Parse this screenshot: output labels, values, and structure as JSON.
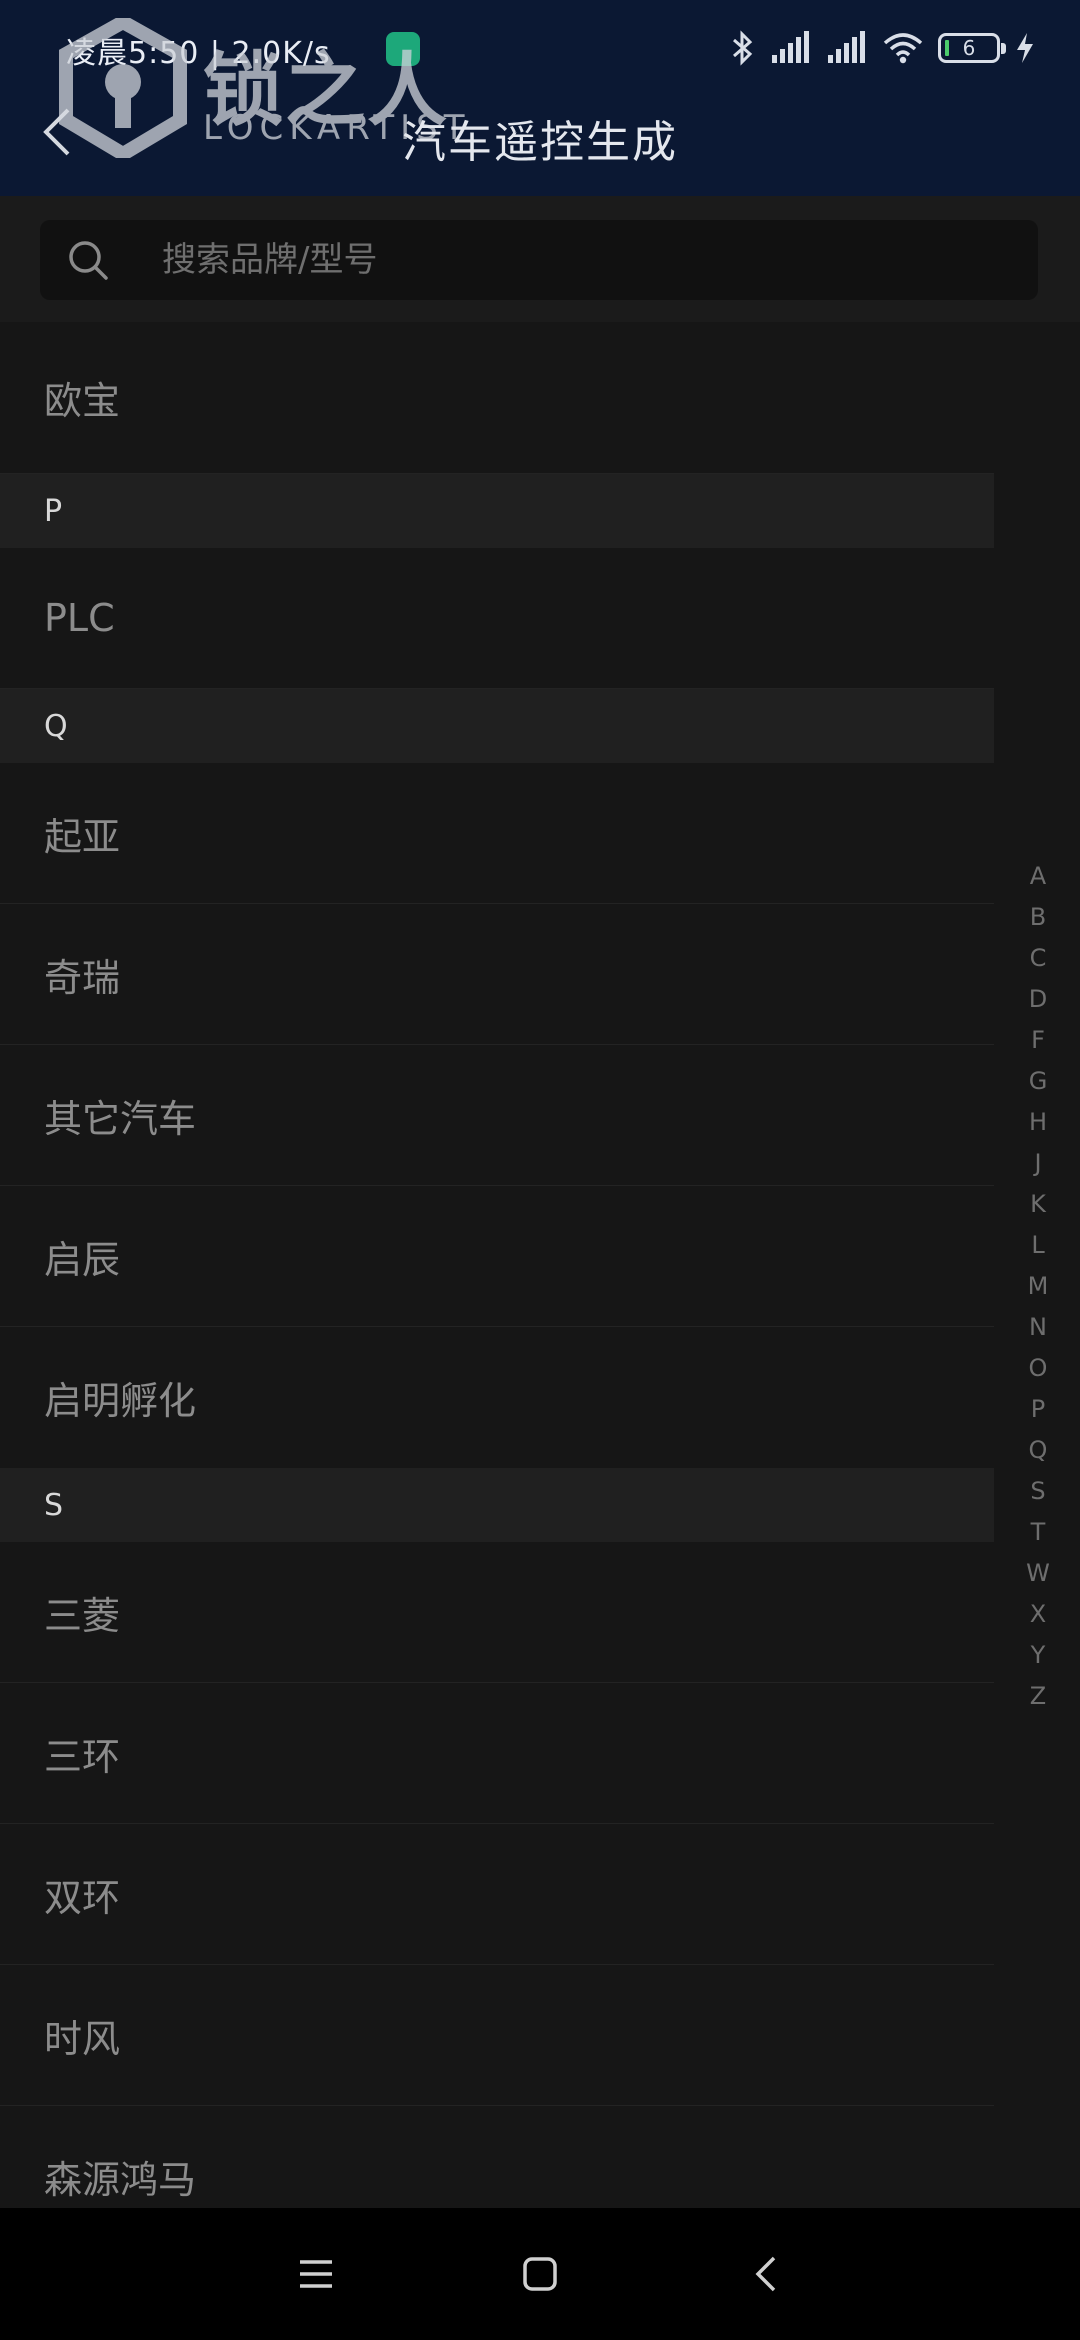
{
  "status_bar": {
    "time": "凌晨5:50 | 2.0K/s",
    "battery_level": "6"
  },
  "watermark": {
    "cn": "锁之人",
    "en": "LOCKARTIST"
  },
  "header": {
    "title": "汽车遥控生成"
  },
  "search": {
    "placeholder": "搜索品牌/型号",
    "value": ""
  },
  "list": {
    "first_item": "欧宝",
    "section_p": {
      "letter": "P",
      "items": [
        "PLC"
      ]
    },
    "section_q": {
      "letter": "Q",
      "items": [
        "起亚",
        "奇瑞",
        "其它汽车",
        "启辰",
        "启明孵化"
      ]
    },
    "section_s": {
      "letter": "S",
      "items": [
        "三菱",
        "三环",
        "双环",
        "时风",
        "森源鸿马"
      ]
    }
  },
  "index_letters": [
    "A",
    "B",
    "C",
    "D",
    "F",
    "G",
    "H",
    "J",
    "K",
    "L",
    "M",
    "N",
    "O",
    "P",
    "Q",
    "S",
    "T",
    "W",
    "X",
    "Y",
    "Z"
  ],
  "colors": {
    "header_bg": "#0b1833",
    "page_bg": "#161616",
    "section_bg": "#202020",
    "badge_green": "#1da87a"
  }
}
